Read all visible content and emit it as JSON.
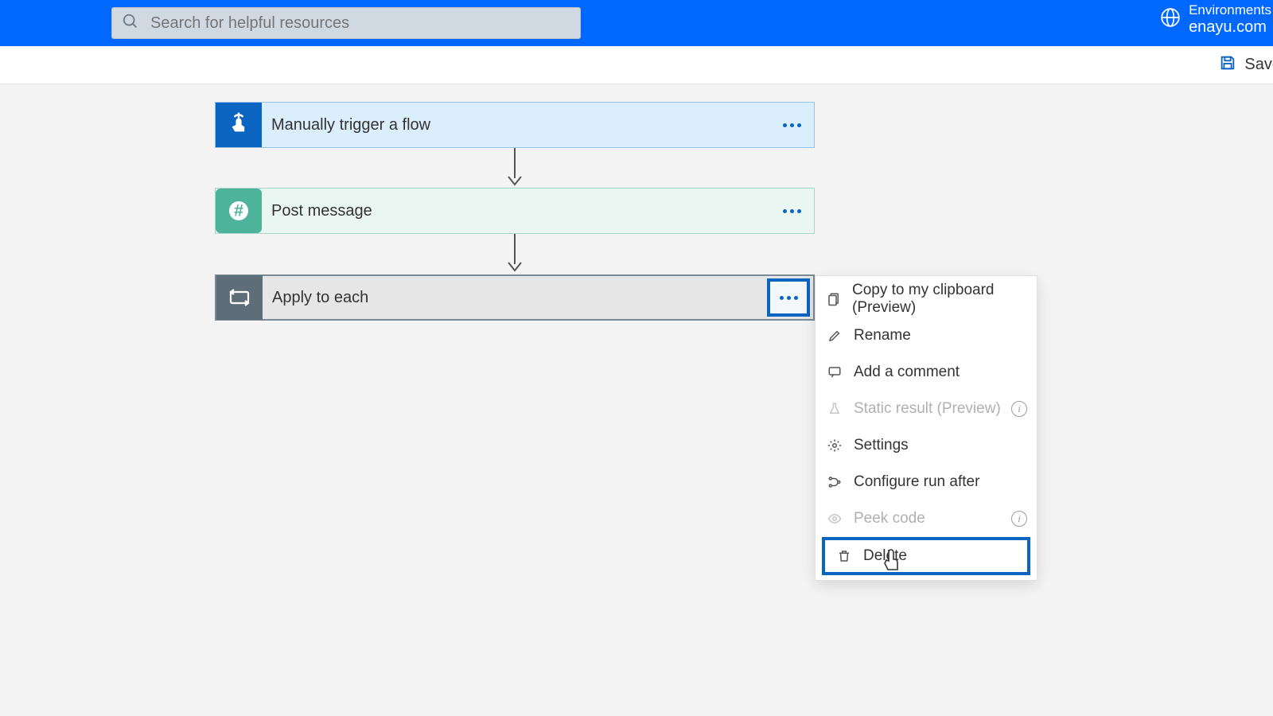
{
  "header": {
    "search_placeholder": "Search for helpful resources",
    "env_label": "Environments",
    "env_value": "enayu.com"
  },
  "toolbar": {
    "save_label": "Save"
  },
  "steps": {
    "trigger": "Manually trigger a flow",
    "post": "Post message",
    "apply": "Apply to each"
  },
  "menu": {
    "copy": "Copy to my clipboard (Preview)",
    "rename": "Rename",
    "comment": "Add a comment",
    "static": "Static result (Preview)",
    "settings": "Settings",
    "runafter": "Configure run after",
    "peek": "Peek code",
    "delete": "Delete"
  }
}
